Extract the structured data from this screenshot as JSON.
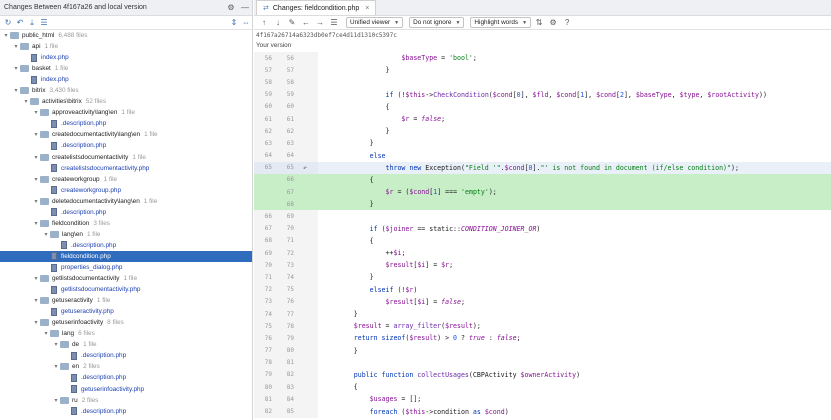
{
  "left_panel": {
    "title": "Changes Between 4f167a26 and local version",
    "tree": [
      {
        "depth": 0,
        "expanded": true,
        "type": "folder",
        "label": "public_html",
        "meta": "6,488 files",
        "selected": false
      },
      {
        "depth": 1,
        "expanded": true,
        "type": "folder",
        "label": "api",
        "meta": "1 file",
        "selected": false
      },
      {
        "depth": 2,
        "expanded": false,
        "type": "file",
        "label": "index.php",
        "meta": "",
        "selected": false
      },
      {
        "depth": 1,
        "expanded": true,
        "type": "folder",
        "label": "basket",
        "meta": "1 file",
        "selected": false
      },
      {
        "depth": 2,
        "expanded": false,
        "type": "file",
        "label": "index.php",
        "meta": "",
        "selected": false
      },
      {
        "depth": 1,
        "expanded": true,
        "type": "folder",
        "label": "bitrix",
        "meta": "3,430 files",
        "selected": false
      },
      {
        "depth": 2,
        "expanded": true,
        "type": "folder",
        "label": "activities\\bitrix",
        "meta": "52 files",
        "selected": false
      },
      {
        "depth": 3,
        "expanded": true,
        "type": "folder",
        "label": "approveactivity\\lang\\en",
        "meta": "1 file",
        "selected": false
      },
      {
        "depth": 4,
        "expanded": false,
        "type": "file",
        "label": ".description.php",
        "meta": "",
        "selected": false
      },
      {
        "depth": 3,
        "expanded": true,
        "type": "folder",
        "label": "createdocumentactivity\\lang\\en",
        "meta": "1 file",
        "selected": false
      },
      {
        "depth": 4,
        "expanded": false,
        "type": "file",
        "label": ".description.php",
        "meta": "",
        "selected": false
      },
      {
        "depth": 3,
        "expanded": true,
        "type": "folder",
        "label": "createlistsdocumentactivity",
        "meta": "1 file",
        "selected": false
      },
      {
        "depth": 4,
        "expanded": false,
        "type": "file",
        "label": "createlistsdocumentactivity.php",
        "meta": "",
        "selected": false
      },
      {
        "depth": 3,
        "expanded": true,
        "type": "folder",
        "label": "createworkgroup",
        "meta": "1 file",
        "selected": false
      },
      {
        "depth": 4,
        "expanded": false,
        "type": "file",
        "label": "createworkgroup.php",
        "meta": "",
        "selected": false
      },
      {
        "depth": 3,
        "expanded": true,
        "type": "folder",
        "label": "deletedocumentactivity\\lang\\en",
        "meta": "1 file",
        "selected": false
      },
      {
        "depth": 4,
        "expanded": false,
        "type": "file",
        "label": ".description.php",
        "meta": "",
        "selected": false
      },
      {
        "depth": 3,
        "expanded": true,
        "type": "folder",
        "label": "fieldcondition",
        "meta": "3 files",
        "selected": false
      },
      {
        "depth": 4,
        "expanded": true,
        "type": "folder",
        "label": "lang\\en",
        "meta": "1 file",
        "selected": false
      },
      {
        "depth": 5,
        "expanded": false,
        "type": "file",
        "label": ".description.php",
        "meta": "",
        "selected": false
      },
      {
        "depth": 4,
        "expanded": false,
        "type": "file",
        "label": "fieldcondition.php",
        "meta": "",
        "selected": true
      },
      {
        "depth": 4,
        "expanded": false,
        "type": "file",
        "label": "properties_dialog.php",
        "meta": "",
        "selected": false
      },
      {
        "depth": 3,
        "expanded": true,
        "type": "folder",
        "label": "getlistsdocumentactivity",
        "meta": "1 file",
        "selected": false
      },
      {
        "depth": 4,
        "expanded": false,
        "type": "file",
        "label": "getlistsdocumentactivity.php",
        "meta": "",
        "selected": false
      },
      {
        "depth": 3,
        "expanded": true,
        "type": "folder",
        "label": "getuseractivity",
        "meta": "1 file",
        "selected": false
      },
      {
        "depth": 4,
        "expanded": false,
        "type": "file",
        "label": "getuseractivity.php",
        "meta": "",
        "selected": false
      },
      {
        "depth": 3,
        "expanded": true,
        "type": "folder",
        "label": "getuserinfoactivity",
        "meta": "8 files",
        "selected": false
      },
      {
        "depth": 4,
        "expanded": true,
        "type": "folder",
        "label": "lang",
        "meta": "6 files",
        "selected": false
      },
      {
        "depth": 5,
        "expanded": true,
        "type": "folder",
        "label": "de",
        "meta": "1 file",
        "selected": false
      },
      {
        "depth": 6,
        "expanded": false,
        "type": "file",
        "label": ".description.php",
        "meta": "",
        "selected": false
      },
      {
        "depth": 5,
        "expanded": true,
        "type": "folder",
        "label": "en",
        "meta": "2 files",
        "selected": false
      },
      {
        "depth": 6,
        "expanded": false,
        "type": "file",
        "label": ".description.php",
        "meta": "",
        "selected": false
      },
      {
        "depth": 6,
        "expanded": false,
        "type": "file",
        "label": "getuserinfoactivity.php",
        "meta": "",
        "selected": false
      },
      {
        "depth": 5,
        "expanded": true,
        "type": "folder",
        "label": "ru",
        "meta": "2 files",
        "selected": false
      },
      {
        "depth": 6,
        "expanded": false,
        "type": "file",
        "label": ".description.php",
        "meta": "",
        "selected": false
      }
    ]
  },
  "right_panel": {
    "tab_label": "Changes: fieldcondition.php",
    "viewer_mode": "Unified viewer",
    "ignore_mode": "Do not ignore",
    "highlight_mode": "Highlight words",
    "hash": "4f167a26714a6323db0ef7ce4d11d1310c5397c",
    "version_label": "Your version"
  },
  "code_lines": [
    {
      "n1": "56",
      "n2": "56",
      "kind": "ctx",
      "mark": "",
      "indent": "            ",
      "segs": [
        {
          "c": "va",
          "t": "$baseType"
        },
        {
          "c": "",
          "t": " = "
        },
        {
          "c": "st",
          "t": "'bool'"
        },
        {
          "c": "",
          "t": ";"
        }
      ]
    },
    {
      "n1": "57",
      "n2": "57",
      "kind": "ctx",
      "mark": "",
      "indent": "        ",
      "segs": [
        {
          "c": "",
          "t": "}"
        }
      ]
    },
    {
      "n1": "58",
      "n2": "58",
      "kind": "ctx",
      "mark": "",
      "indent": "",
      "segs": []
    },
    {
      "n1": "59",
      "n2": "59",
      "kind": "ctx",
      "mark": "",
      "indent": "        ",
      "segs": [
        {
          "c": "kw",
          "t": "if"
        },
        {
          "c": "",
          "t": " (!"
        },
        {
          "c": "va",
          "t": "$this"
        },
        {
          "c": "",
          "t": "->"
        },
        {
          "c": "fn",
          "t": "CheckCondition"
        },
        {
          "c": "",
          "t": "("
        },
        {
          "c": "va",
          "t": "$cond"
        },
        {
          "c": "",
          "t": "["
        },
        {
          "c": "nu",
          "t": "0"
        },
        {
          "c": "",
          "t": "], "
        },
        {
          "c": "va",
          "t": "$fld"
        },
        {
          "c": "",
          "t": ", "
        },
        {
          "c": "va",
          "t": "$cond"
        },
        {
          "c": "",
          "t": "["
        },
        {
          "c": "nu",
          "t": "1"
        },
        {
          "c": "",
          "t": "], "
        },
        {
          "c": "va",
          "t": "$cond"
        },
        {
          "c": "",
          "t": "["
        },
        {
          "c": "nu",
          "t": "2"
        },
        {
          "c": "",
          "t": "], "
        },
        {
          "c": "va",
          "t": "$baseType"
        },
        {
          "c": "",
          "t": ", "
        },
        {
          "c": "va",
          "t": "$type"
        },
        {
          "c": "",
          "t": ", "
        },
        {
          "c": "va",
          "t": "$rootActivity"
        },
        {
          "c": "",
          "t": "))"
        }
      ]
    },
    {
      "n1": "60",
      "n2": "60",
      "kind": "ctx",
      "mark": "",
      "indent": "        ",
      "segs": [
        {
          "c": "",
          "t": "{"
        }
      ]
    },
    {
      "n1": "61",
      "n2": "61",
      "kind": "ctx",
      "mark": "",
      "indent": "            ",
      "segs": [
        {
          "c": "va",
          "t": "$r"
        },
        {
          "c": "",
          "t": " = "
        },
        {
          "c": "it",
          "t": "false"
        },
        {
          "c": "",
          "t": ";"
        }
      ]
    },
    {
      "n1": "62",
      "n2": "62",
      "kind": "ctx",
      "mark": "",
      "indent": "        ",
      "segs": [
        {
          "c": "",
          "t": "}"
        }
      ]
    },
    {
      "n1": "63",
      "n2": "63",
      "kind": "ctx",
      "mark": "",
      "indent": "    ",
      "segs": [
        {
          "c": "",
          "t": "}"
        }
      ]
    },
    {
      "n1": "64",
      "n2": "64",
      "kind": "ctx",
      "mark": "",
      "indent": "    ",
      "segs": [
        {
          "c": "kw",
          "t": "else"
        }
      ]
    },
    {
      "n1": "65",
      "n2": "65",
      "kind": "mod",
      "mark": "↶",
      "indent": "        ",
      "segs": [
        {
          "c": "kw",
          "t": "throw new"
        },
        {
          "c": "",
          "t": " Exception("
        },
        {
          "c": "st",
          "t": "\"Field '\""
        },
        {
          "c": "",
          "t": "."
        },
        {
          "c": "va",
          "t": "$cond"
        },
        {
          "c": "",
          "t": "["
        },
        {
          "c": "nu",
          "t": "0"
        },
        {
          "c": "",
          "t": "]."
        },
        {
          "c": "st",
          "t": "\"' is not found in document (if/else condition)\""
        },
        {
          "c": "",
          "t": ");"
        }
      ]
    },
    {
      "n1": "",
      "n2": "66",
      "kind": "add",
      "mark": "",
      "indent": "    ",
      "segs": [
        {
          "c": "",
          "t": "{"
        }
      ]
    },
    {
      "n1": "",
      "n2": "67",
      "kind": "add",
      "mark": "",
      "indent": "        ",
      "segs": [
        {
          "c": "va",
          "t": "$r"
        },
        {
          "c": "",
          "t": " = ("
        },
        {
          "c": "va",
          "t": "$cond"
        },
        {
          "c": "",
          "t": "["
        },
        {
          "c": "nu",
          "t": "1"
        },
        {
          "c": "",
          "t": "] === "
        },
        {
          "c": "st",
          "t": "'empty'"
        },
        {
          "c": "",
          "t": ");"
        }
      ]
    },
    {
      "n1": "",
      "n2": "68",
      "kind": "add",
      "mark": "",
      "indent": "    ",
      "segs": [
        {
          "c": "",
          "t": "}"
        }
      ]
    },
    {
      "n1": "66",
      "n2": "69",
      "kind": "ctx",
      "mark": "",
      "indent": "",
      "segs": []
    },
    {
      "n1": "67",
      "n2": "70",
      "kind": "ctx",
      "mark": "",
      "indent": "    ",
      "segs": [
        {
          "c": "kw",
          "t": "if"
        },
        {
          "c": "",
          "t": " ("
        },
        {
          "c": "va",
          "t": "$joiner"
        },
        {
          "c": "",
          "t": " == static::"
        },
        {
          "c": "cn",
          "t": "CONDITION_JOINER_OR"
        },
        {
          "c": "",
          "t": ")"
        }
      ]
    },
    {
      "n1": "68",
      "n2": "71",
      "kind": "ctx",
      "mark": "",
      "indent": "    ",
      "segs": [
        {
          "c": "",
          "t": "{"
        }
      ]
    },
    {
      "n1": "69",
      "n2": "72",
      "kind": "ctx",
      "mark": "",
      "indent": "        ",
      "segs": [
        {
          "c": "",
          "t": "++"
        },
        {
          "c": "va",
          "t": "$i"
        },
        {
          "c": "",
          "t": ";"
        }
      ]
    },
    {
      "n1": "70",
      "n2": "73",
      "kind": "ctx",
      "mark": "",
      "indent": "        ",
      "segs": [
        {
          "c": "va",
          "t": "$result"
        },
        {
          "c": "",
          "t": "["
        },
        {
          "c": "va",
          "t": "$i"
        },
        {
          "c": "",
          "t": "] = "
        },
        {
          "c": "va",
          "t": "$r"
        },
        {
          "c": "",
          "t": ";"
        }
      ]
    },
    {
      "n1": "71",
      "n2": "74",
      "kind": "ctx",
      "mark": "",
      "indent": "    ",
      "segs": [
        {
          "c": "",
          "t": "}"
        }
      ]
    },
    {
      "n1": "72",
      "n2": "75",
      "kind": "ctx",
      "mark": "",
      "indent": "    ",
      "segs": [
        {
          "c": "kw",
          "t": "elseif"
        },
        {
          "c": "",
          "t": " (!"
        },
        {
          "c": "va",
          "t": "$r"
        },
        {
          "c": "",
          "t": ")"
        }
      ]
    },
    {
      "n1": "73",
      "n2": "76",
      "kind": "ctx",
      "mark": "",
      "indent": "        ",
      "segs": [
        {
          "c": "va",
          "t": "$result"
        },
        {
          "c": "",
          "t": "["
        },
        {
          "c": "va",
          "t": "$i"
        },
        {
          "c": "",
          "t": "] = "
        },
        {
          "c": "it",
          "t": "false"
        },
        {
          "c": "",
          "t": ";"
        }
      ]
    },
    {
      "n1": "74",
      "n2": "77",
      "kind": "ctx",
      "mark": "",
      "indent": "",
      "segs": [
        {
          "c": "",
          "t": "}"
        }
      ]
    },
    {
      "n1": "75",
      "n2": "78",
      "kind": "ctx",
      "mark": "",
      "indent": "",
      "segs": [
        {
          "c": "va",
          "t": "$result"
        },
        {
          "c": "",
          "t": " = "
        },
        {
          "c": "fn",
          "t": "array_filter"
        },
        {
          "c": "",
          "t": "("
        },
        {
          "c": "va",
          "t": "$result"
        },
        {
          "c": "",
          "t": ");"
        }
      ]
    },
    {
      "n1": "76",
      "n2": "79",
      "kind": "ctx",
      "mark": "",
      "indent": "",
      "segs": [
        {
          "c": "kw",
          "t": "return sizeof"
        },
        {
          "c": "",
          "t": "("
        },
        {
          "c": "va",
          "t": "$result"
        },
        {
          "c": "",
          "t": ") > "
        },
        {
          "c": "nu",
          "t": "0"
        },
        {
          "c": "",
          "t": " ? "
        },
        {
          "c": "it",
          "t": "true"
        },
        {
          "c": "",
          "t": " : "
        },
        {
          "c": "it",
          "t": "false"
        },
        {
          "c": "",
          "t": ";"
        }
      ]
    },
    {
      "n1": "77",
      "n2": "80",
      "kind": "ctx",
      "mark": "",
      "indent": "",
      "segs": [
        {
          "c": "",
          "t": "}"
        }
      ]
    },
    {
      "n1": "78",
      "n2": "81",
      "kind": "ctx",
      "mark": "",
      "indent": "",
      "segs": []
    },
    {
      "n1": "79",
      "n2": "82",
      "kind": "ctx",
      "mark": "",
      "indent": "",
      "segs": [
        {
          "c": "kw",
          "t": "public function"
        },
        {
          "c": "",
          "t": " "
        },
        {
          "c": "fn",
          "t": "collectUsages"
        },
        {
          "c": "",
          "t": "(CBPActivity "
        },
        {
          "c": "va",
          "t": "$ownerActivity"
        },
        {
          "c": "",
          "t": ")"
        }
      ]
    },
    {
      "n1": "80",
      "n2": "83",
      "kind": "ctx",
      "mark": "",
      "indent": "",
      "segs": [
        {
          "c": "",
          "t": "{"
        }
      ]
    },
    {
      "n1": "81",
      "n2": "84",
      "kind": "ctx",
      "mark": "",
      "indent": "    ",
      "segs": [
        {
          "c": "va",
          "t": "$usages"
        },
        {
          "c": "",
          "t": " = [];"
        }
      ]
    },
    {
      "n1": "82",
      "n2": "85",
      "kind": "ctx",
      "mark": "",
      "indent": "    ",
      "segs": [
        {
          "c": "kw",
          "t": "foreach"
        },
        {
          "c": "",
          "t": " ("
        },
        {
          "c": "va",
          "t": "$this"
        },
        {
          "c": "",
          "t": "->condition "
        },
        {
          "c": "kw",
          "t": "as"
        },
        {
          "c": "",
          "t": " "
        },
        {
          "c": "va",
          "t": "$cond"
        },
        {
          "c": "",
          "t": ")"
        }
      ]
    }
  ],
  "icons": {
    "refresh": "refresh-icon",
    "expand": "expand-all-icon",
    "collapse": "collapse-all-icon",
    "settings": "gear-icon",
    "minimize": "minimize-icon"
  }
}
